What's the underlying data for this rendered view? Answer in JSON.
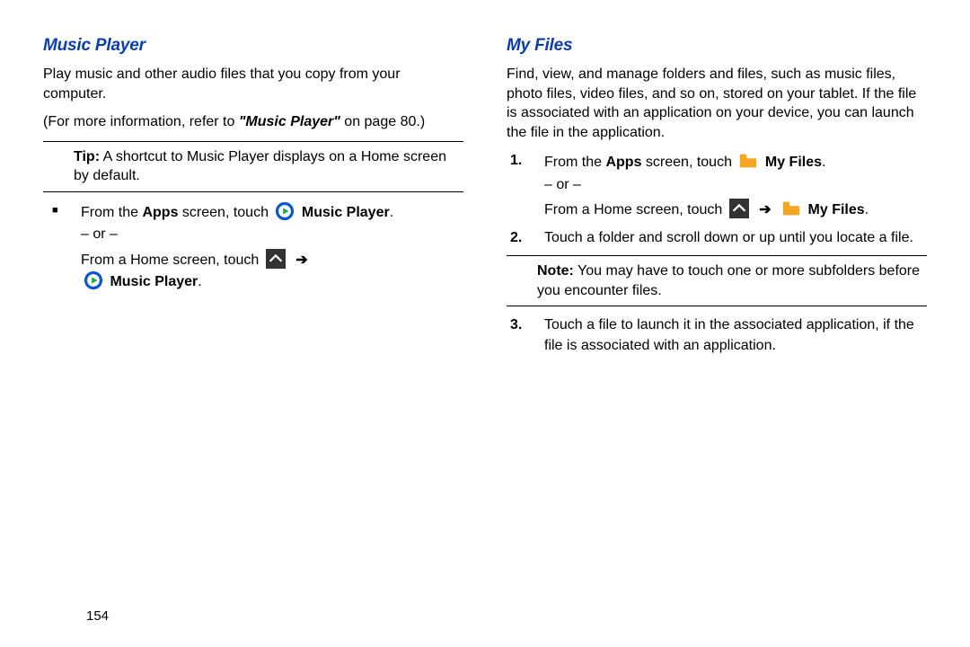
{
  "page_number": "154",
  "left": {
    "heading": "Music Player",
    "p1": "Play music and other audio files that you copy from your computer.",
    "ref_pre": "(For more information, refer to ",
    "ref_link": "\"Music Player\"",
    "ref_post": " on page 80.)",
    "tip_lead": "Tip:",
    "tip_body": " A shortcut to Music Player displays on a Home screen by default.",
    "bullet": {
      "line1_pre": "From the ",
      "line1_apps": "Apps",
      "line1_mid": " screen, touch ",
      "line1_app": "Music Player",
      "or": "– or –",
      "line2_pre": "From a Home screen, touch ",
      "arrow": "➔",
      "line3_app": "Music Player",
      "period": "."
    }
  },
  "right": {
    "heading": "My Files",
    "p1": "Find, view, and manage folders and files, such as music files, photo files, video files, and so on, stored on your tablet. If the file is associated with an application on your device, you can launch the file in the application.",
    "step1": {
      "num": "1.",
      "line1_pre": "From the ",
      "line1_apps": "Apps",
      "line1_mid": " screen, touch ",
      "line1_app": "My Files",
      "or": "– or –",
      "line2_pre": "From a Home screen, touch ",
      "arrow": "➔",
      "line2_app": "My Files",
      "period": "."
    },
    "step2": {
      "num": "2.",
      "text": "Touch a folder and scroll down or up until you locate a file."
    },
    "note_lead": "Note:",
    "note_body": " You may have to touch one or more subfolders before you encounter files.",
    "step3": {
      "num": "3.",
      "text": "Touch a file to launch it in the associated application, if the file is associated with an application."
    }
  },
  "icons": {
    "music_player": "music-player-icon",
    "apps_up": "apps-up-icon",
    "folder": "folder-icon"
  }
}
